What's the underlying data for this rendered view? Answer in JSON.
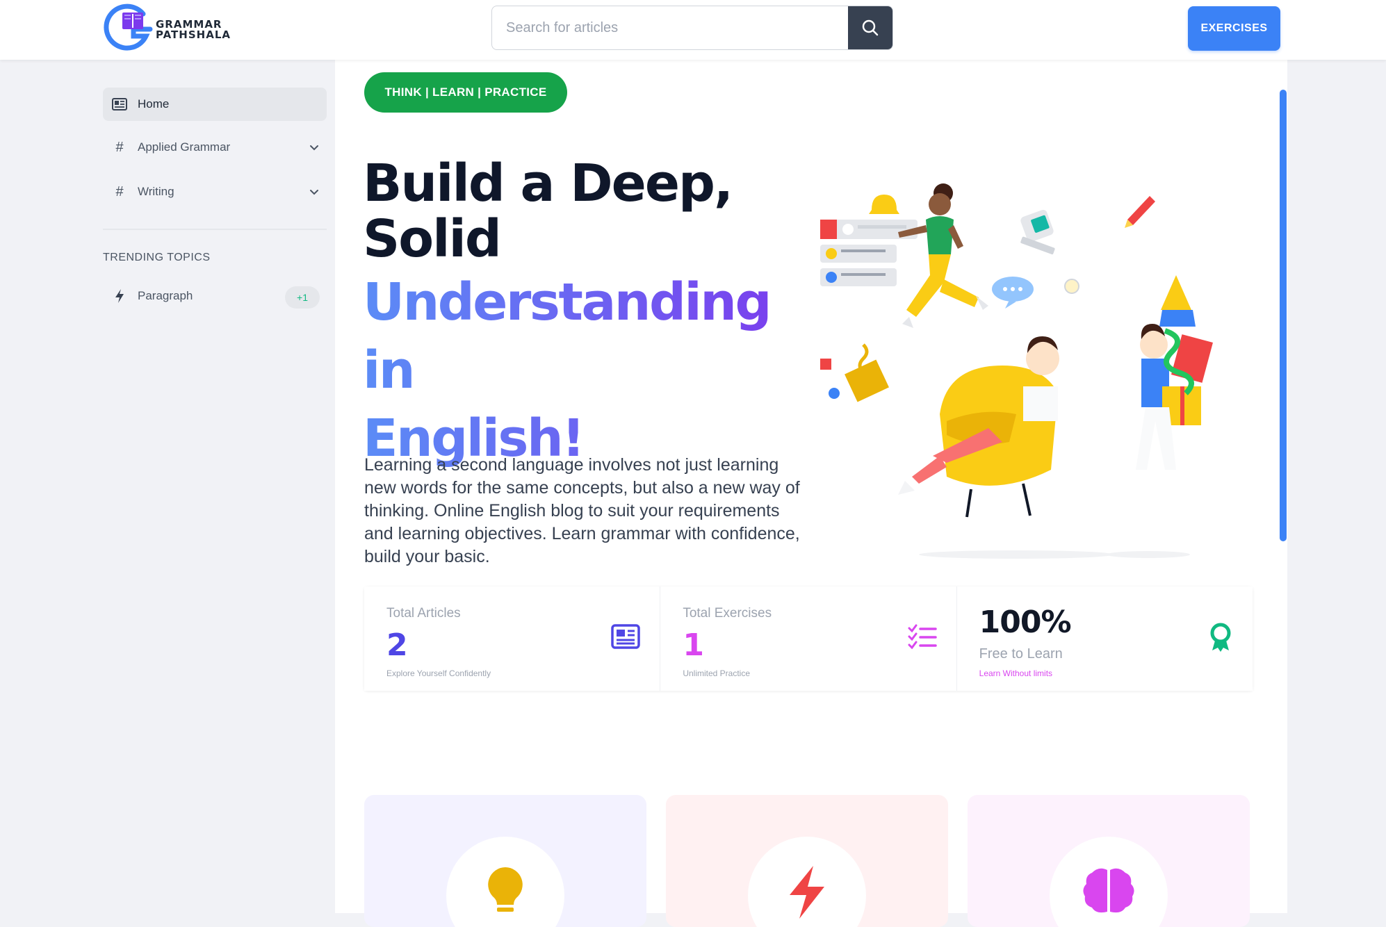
{
  "header": {
    "logo": {
      "line1": "GRAMMAR",
      "line2": "PATHSHALA",
      "mark_color": "#3b82f6",
      "book_color": "#7c3aed"
    },
    "search": {
      "placeholder": "Search for articles",
      "value": ""
    },
    "exercises_label": "EXERCISES"
  },
  "sidebar": {
    "items": [
      {
        "label": "Home",
        "icon": "newspaper-icon",
        "active": true
      },
      {
        "label": "Applied Grammar",
        "icon": "hash-icon",
        "expandable": true
      },
      {
        "label": "Writing",
        "icon": "hash-icon",
        "expandable": true
      }
    ],
    "trending_title": "TRENDING TOPICS",
    "trending": [
      {
        "label": "Paragraph",
        "icon": "bolt-icon",
        "badge": "+1"
      }
    ]
  },
  "hero": {
    "tagline": "THINK | LEARN | PRACTICE",
    "title_line1": "Build a Deep,",
    "title_line2": "Solid",
    "title_line3": "Understanding in",
    "title_line4": "English!",
    "description": "Learning a second language involves not just learning new words for the same concepts, but also a new way of thinking. Online English blog to suit your requirements and learning objectives. Learn grammar with confidence, build your basic."
  },
  "stats": [
    {
      "label": "Total Articles",
      "value": "2",
      "sub": "Explore Yourself Confidently",
      "color": "#4f46e5",
      "icon": "newspaper-icon"
    },
    {
      "label": "Total Exercises",
      "value": "1",
      "sub": "Unlimited Practice",
      "color": "#d946ef",
      "icon": "checklist-icon"
    },
    {
      "value": "100%",
      "label": "Free to Learn",
      "sub": "Learn Without limits",
      "color": "#10b981",
      "icon": "award-icon"
    }
  ],
  "feature_cards": [
    {
      "icon": "lightbulb-icon",
      "bg": "#f3f2ff",
      "icon_color": "#eab308"
    },
    {
      "icon": "lightning-icon",
      "bg": "#fff1f2",
      "icon_color": "#ef4444"
    },
    {
      "icon": "brain-icon",
      "bg": "#fdf2fd",
      "icon_color": "#d946ef"
    }
  ],
  "colors": {
    "accent": "#3b82f6",
    "tag_green": "#16a34a",
    "gradient_start": "#5b8cf6",
    "gradient_end": "#7c3aed"
  }
}
